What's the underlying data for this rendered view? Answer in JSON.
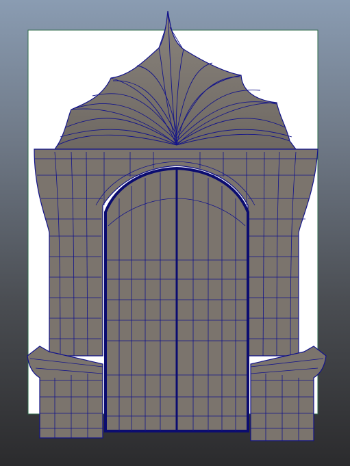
{
  "viewport": {
    "title": "",
    "background_top_color": "#8a9cb2",
    "background_bottom_color": "#2b2b2d",
    "image_plane_color": "#ffffff",
    "mesh_fill_color": "#7b746d",
    "wireframe_color": "#12138a",
    "subject": "gothic-arch-doorway-mesh"
  }
}
